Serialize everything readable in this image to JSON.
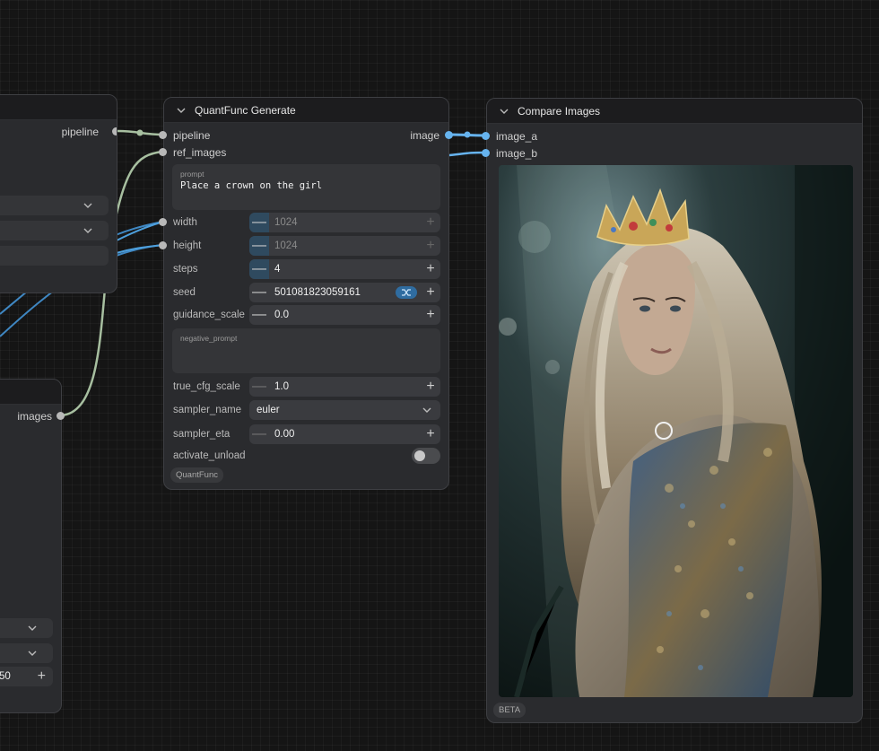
{
  "left_node_top": {
    "output_label": "pipeline"
  },
  "left_node_bottom": {
    "output_label": "images",
    "partial_value": "50"
  },
  "generate_node": {
    "title": "QuantFunc Generate",
    "inputs": [
      "pipeline",
      "ref_images"
    ],
    "output_label": "image",
    "prompt_label": "prompt",
    "prompt_value": "Place a crown on the girl",
    "width_label": "width",
    "width_value": "1024",
    "height_label": "height",
    "height_value": "1024",
    "steps_label": "steps",
    "steps_value": "4",
    "seed_label": "seed",
    "seed_value": "501081823059161",
    "guidance_label": "guidance_scale",
    "guidance_value": "0.0",
    "negative_label": "negative_prompt",
    "true_cfg_label": "true_cfg_scale",
    "true_cfg_value": "1.0",
    "sampler_label": "sampler_name",
    "sampler_value": "euler",
    "eta_label": "sampler_eta",
    "eta_value": "0.00",
    "unload_label": "activate_unload",
    "badge": "QuantFunc"
  },
  "compare_node": {
    "title": "Compare Images",
    "inputs": [
      "image_a",
      "image_b"
    ],
    "badge": "BETA",
    "image_alt": "woman with crown in forest"
  },
  "colors": {
    "canvas": "#151515",
    "node": "#2a2b2e",
    "wire_green": "#a7bfa0",
    "wire_blue": "#4d9fdc"
  }
}
